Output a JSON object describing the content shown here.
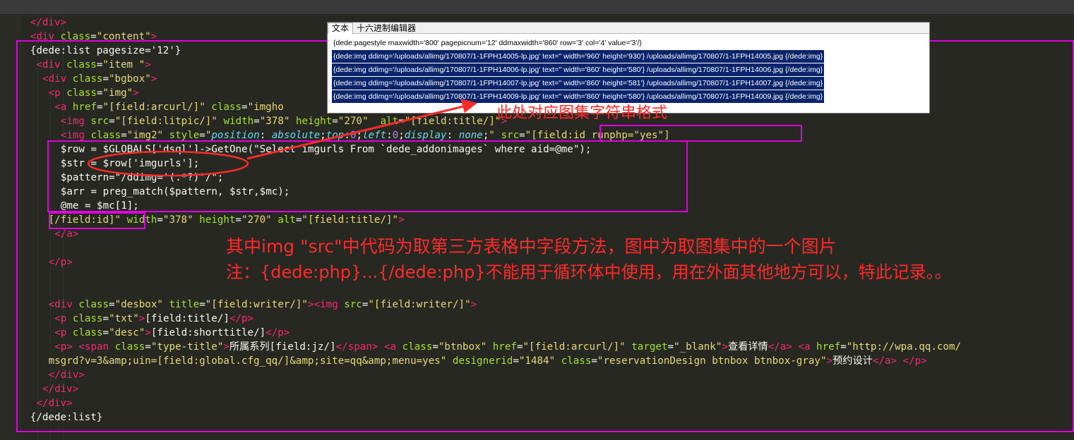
{
  "code_lines": [
    {
      "parts": [
        [
          "t",
          "</div>"
        ]
      ]
    },
    {
      "parts": [
        [
          "t",
          "<div "
        ],
        [
          "a",
          "class"
        ],
        [
          "p",
          "="
        ],
        [
          "s",
          "\"content\""
        ],
        [
          "t",
          ">"
        ]
      ]
    },
    {
      "parts": [
        [
          "p",
          "{dede:list pagesize='12'}"
        ]
      ]
    },
    {
      "parts": [
        [
          "t",
          "<div "
        ],
        [
          "a",
          "class"
        ],
        [
          "p",
          "="
        ],
        [
          "s",
          "\"item \""
        ],
        [
          "t",
          ">"
        ]
      ]
    },
    {
      "parts": [
        [
          "t",
          "<div "
        ],
        [
          "a",
          "class"
        ],
        [
          "p",
          "="
        ],
        [
          "s",
          "\"bgbox\""
        ],
        [
          "t",
          ">"
        ]
      ]
    },
    {
      "parts": [
        [
          "t",
          "<p "
        ],
        [
          "a",
          "class"
        ],
        [
          "p",
          "="
        ],
        [
          "s",
          "\"img\""
        ],
        [
          "t",
          ">"
        ]
      ]
    },
    {
      "parts": [
        [
          "t",
          "<a "
        ],
        [
          "a",
          "href"
        ],
        [
          "p",
          "="
        ],
        [
          "s",
          "\"[field:arcurl/]\""
        ],
        [
          "p",
          " "
        ],
        [
          "a",
          "class"
        ],
        [
          "p",
          "="
        ],
        [
          "s",
          "\"imgho"
        ]
      ]
    },
    {
      "parts": [
        [
          "t",
          "<img "
        ],
        [
          "a",
          "src"
        ],
        [
          "p",
          "="
        ],
        [
          "s",
          "\"[field:litpic/]\""
        ],
        [
          "p",
          " "
        ],
        [
          "a",
          "width"
        ],
        [
          "p",
          "="
        ],
        [
          "s",
          "\"378\""
        ],
        [
          "p",
          " "
        ],
        [
          "a",
          "height"
        ],
        [
          "p",
          "="
        ],
        [
          "s",
          "\"270\""
        ],
        [
          "p",
          "  "
        ],
        [
          "a",
          "alt"
        ],
        [
          "p",
          "="
        ],
        [
          "s",
          "\"[field:title/]\""
        ],
        [
          "t",
          ">"
        ]
      ]
    },
    {
      "parts": [
        [
          "t",
          "<img "
        ],
        [
          "a",
          "class"
        ],
        [
          "p",
          "="
        ],
        [
          "s",
          "\"img2\""
        ],
        [
          "p",
          " "
        ],
        [
          "a",
          "style"
        ],
        [
          "p",
          "="
        ],
        [
          "s",
          "\""
        ],
        [
          "k",
          "position"
        ],
        [
          "p",
          ": "
        ],
        [
          "k",
          "absolute"
        ],
        [
          "p",
          ";"
        ],
        [
          "k",
          "top"
        ],
        [
          "p",
          ":"
        ],
        [
          "n",
          "0"
        ],
        [
          "p",
          ";"
        ],
        [
          "k",
          "left"
        ],
        [
          "p",
          ":"
        ],
        [
          "n",
          "0"
        ],
        [
          "p",
          ";"
        ],
        [
          "k",
          "display"
        ],
        [
          "p",
          ": "
        ],
        [
          "k",
          "none"
        ],
        [
          "p",
          ";"
        ],
        [
          "s",
          "\""
        ],
        [
          "p",
          " "
        ],
        [
          "a",
          "src"
        ],
        [
          "p",
          "="
        ],
        [
          "s",
          "\"[field:id runphp=\"yes\"]"
        ]
      ]
    },
    {
      "parts": [
        [
          "v",
          "$row = $GLOBALS['dsql']->GetOne(\"Select imgurls From `dede_addonimages` where aid=@me\");"
        ]
      ]
    },
    {
      "parts": [
        [
          "v",
          "$str = $row['imgurls'];"
        ]
      ]
    },
    {
      "parts": [
        [
          "v",
          "$pattern=\"/ddimg='(.*?)'/\";"
        ]
      ]
    },
    {
      "parts": [
        [
          "v",
          "$arr = preg_match($pattern, $str,$mc);"
        ]
      ]
    },
    {
      "parts": [
        [
          "v",
          "@me = $mc[1];"
        ]
      ]
    },
    {
      "parts": [
        [
          "s",
          "[/field:id]\""
        ],
        [
          "p",
          " "
        ],
        [
          "a",
          "width"
        ],
        [
          "p",
          "="
        ],
        [
          "s",
          "\"378\""
        ],
        [
          "p",
          " "
        ],
        [
          "a",
          "height"
        ],
        [
          "p",
          "="
        ],
        [
          "s",
          "\"270\""
        ],
        [
          "p",
          " "
        ],
        [
          "a",
          "alt"
        ],
        [
          "p",
          "="
        ],
        [
          "s",
          "\"[field:title/]\""
        ],
        [
          "t",
          ">"
        ]
      ]
    },
    {
      "parts": [
        [
          "t",
          "</a>"
        ]
      ]
    },
    {
      "parts": []
    },
    {
      "parts": [
        [
          "t",
          "</p>"
        ]
      ]
    },
    {
      "parts": []
    },
    {
      "parts": []
    },
    {
      "parts": [
        [
          "t",
          "<div "
        ],
        [
          "a",
          "class"
        ],
        [
          "p",
          "="
        ],
        [
          "s",
          "\"desbox\""
        ],
        [
          "p",
          " "
        ],
        [
          "a",
          "title"
        ],
        [
          "p",
          "="
        ],
        [
          "s",
          "\"[field:writer/]\""
        ],
        [
          "t",
          ">"
        ],
        [
          "t",
          "<img "
        ],
        [
          "a",
          "src"
        ],
        [
          "p",
          "="
        ],
        [
          "s",
          "\"[field:writer/]\""
        ],
        [
          "t",
          ">"
        ]
      ]
    },
    {
      "parts": [
        [
          "t",
          "<p "
        ],
        [
          "a",
          "class"
        ],
        [
          "p",
          "="
        ],
        [
          "s",
          "\"txt\""
        ],
        [
          "t",
          ">"
        ],
        [
          "p",
          "[field:title/]"
        ],
        [
          "t",
          "</p>"
        ]
      ]
    },
    {
      "parts": [
        [
          "t",
          "<p "
        ],
        [
          "a",
          "class"
        ],
        [
          "p",
          "="
        ],
        [
          "s",
          "\"desc\""
        ],
        [
          "t",
          ">"
        ],
        [
          "p",
          "[field:shorttitle/]"
        ],
        [
          "t",
          "</p>"
        ]
      ]
    },
    {
      "parts": [
        [
          "t",
          "<p>"
        ],
        [
          "p",
          " "
        ],
        [
          "t",
          "<span "
        ],
        [
          "a",
          "class"
        ],
        [
          "p",
          "="
        ],
        [
          "s",
          "\"type-title\""
        ],
        [
          "t",
          ">"
        ],
        [
          "p",
          "所属系列[field:jz/]"
        ],
        [
          "t",
          "</span>"
        ],
        [
          "p",
          " "
        ],
        [
          "t",
          "<a "
        ],
        [
          "a",
          "class"
        ],
        [
          "p",
          "="
        ],
        [
          "s",
          "\"btnbox\""
        ],
        [
          "p",
          " "
        ],
        [
          "a",
          "href"
        ],
        [
          "p",
          "="
        ],
        [
          "s",
          "\"[field:arcurl/]\""
        ],
        [
          "p",
          " "
        ],
        [
          "a",
          "target"
        ],
        [
          "p",
          "="
        ],
        [
          "s",
          "\"_blank\""
        ],
        [
          "t",
          ">"
        ],
        [
          "p",
          "查看详情"
        ],
        [
          "t",
          "</a>"
        ],
        [
          "p",
          " "
        ],
        [
          "t",
          "<a "
        ],
        [
          "a",
          "href"
        ],
        [
          "p",
          "="
        ],
        [
          "s",
          "\"http://wpa.qq.com/"
        ]
      ]
    },
    {
      "parts": [
        [
          "s",
          "msgrd?v=3&amp;uin=[field:global.cfg_qq/]&amp;site=qq&amp;menu=yes\""
        ],
        [
          "p",
          " "
        ],
        [
          "a",
          "designerid"
        ],
        [
          "p",
          "="
        ],
        [
          "s",
          "\"1484\""
        ],
        [
          "p",
          " "
        ],
        [
          "a",
          "class"
        ],
        [
          "p",
          "="
        ],
        [
          "s",
          "\"reservationDesign btnbox btnbox-gray\""
        ],
        [
          "t",
          ">"
        ],
        [
          "p",
          "预约设计"
        ],
        [
          "t",
          "</a>"
        ],
        [
          "p",
          " "
        ],
        [
          "t",
          "</p>"
        ]
      ]
    },
    {
      "parts": [
        [
          "t",
          "</div>"
        ]
      ]
    },
    {
      "parts": [
        [
          "t",
          "</div>"
        ]
      ]
    },
    {
      "parts": [
        [
          "t",
          "</div>"
        ]
      ]
    },
    {
      "parts": [
        [
          "p",
          "{/dede:list}"
        ]
      ]
    }
  ],
  "popup": {
    "tabs": [
      "文本",
      "十六进制编辑器"
    ],
    "lines": [
      "{dede:pagestyle maxwidth='800' pagepicnum='12' ddmaxwidth='860' row='3' col='4' value='3'/}",
      "{dede:img ddimg='/uploads/allimg/170807/1-1FPH14005-lp.jpg' text='' width='960' height='930'} /uploads/allimg/170807/1-1FPH14005.jpg {/dede:img}",
      "{dede:img ddimg='/uploads/allimg/170807/1-1FPH14006-lp.jpg' text='' width='860' height='580'} /uploads/allimg/170807/1-1FPH14006.jpg {/dede:img}",
      "{dede:img ddimg='/uploads/allimg/170807/1-1FPH14007-lp.jpg' text='' width='860' height='581'} /uploads/allimg/170807/1-1FPH14007.jpg {/dede:img}",
      "{dede:img ddimg='/uploads/allimg/170807/1-1FPH14009-lp.jpg' text='' width='860' height='580'} /uploads/allimg/170807/1-1FPH14009.jpg {/dede:img}"
    ]
  },
  "annotations": {
    "arrow_note": "此处对应图集字符串格式",
    "note1": "其中img \"src\"中代码为取第三方表格中字段方法，图中为取图集中的一个图片",
    "note2": "注：{dede:php}...{/dede:php}不能用于循环体中使用，用在外面其他地方可以，特此记录。。"
  },
  "colors": {
    "background": "#272822",
    "tag": "#f92672",
    "attribute": "#a6e22e",
    "string": "#e6db74",
    "keyword": "#66d9ef",
    "number": "#ae81ff",
    "annotation": "#ff2a2a",
    "highlight_box": "#e000e0"
  }
}
